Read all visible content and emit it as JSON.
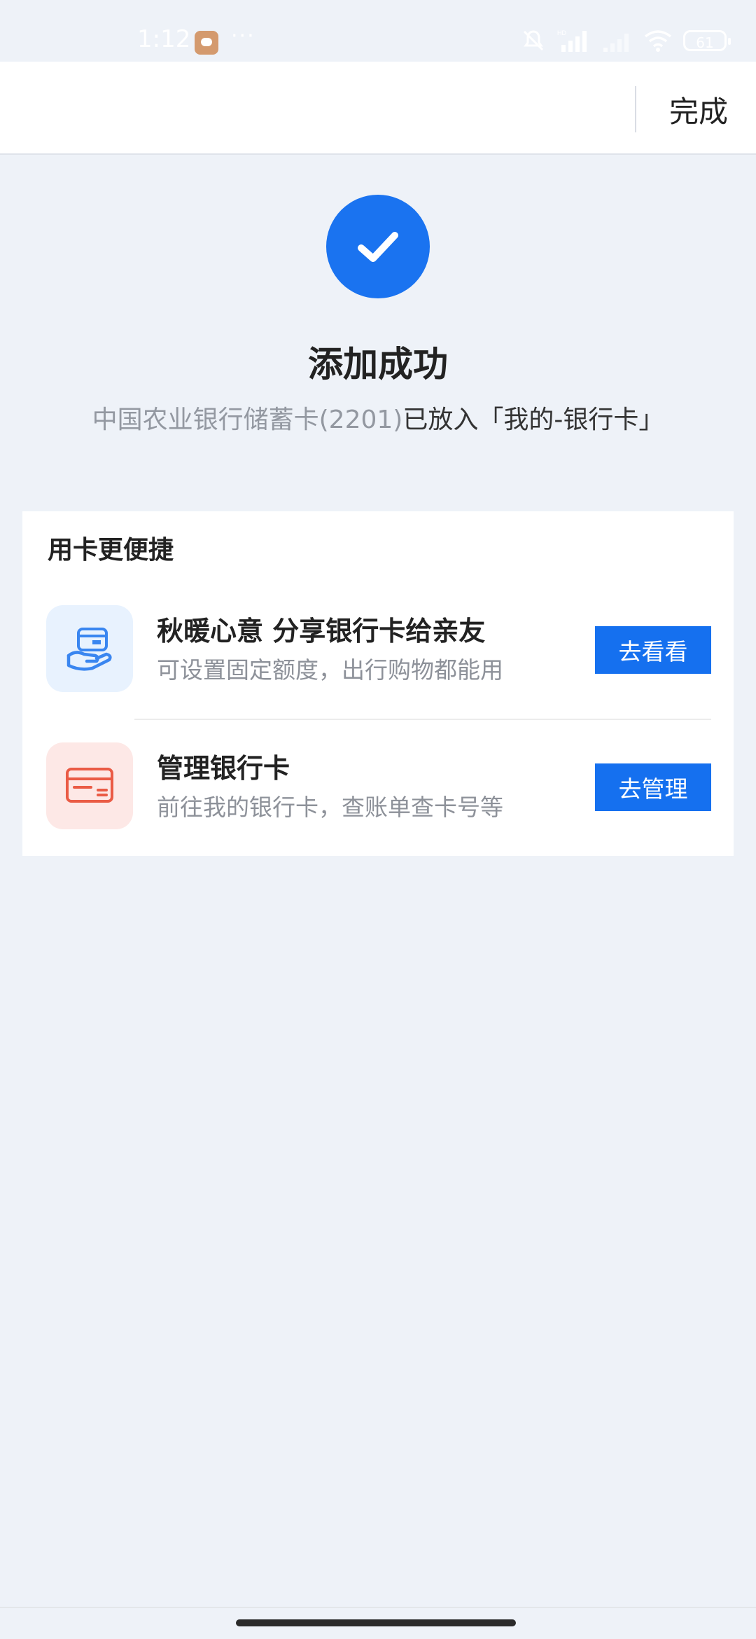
{
  "status_bar": {
    "time": "1:12",
    "dots": "···",
    "battery": "61",
    "icons": [
      "chat-app-icon",
      "bell-muted-icon",
      "signal-hd-icon",
      "signal-icon",
      "wifi-icon",
      "battery-icon"
    ]
  },
  "nav": {
    "done_label": "完成"
  },
  "success": {
    "icon": "check-icon",
    "title": "添加成功",
    "desc_prefix": "中国农业银行储蓄卡(2201)",
    "desc_suffix": "已放入「我的-银行卡」"
  },
  "card": {
    "title": "用卡更便捷",
    "items": [
      {
        "icon": "share-card-hand-icon",
        "title": "秋暖心意 分享银行卡给亲友",
        "subtitle": "可设置固定额度，出行购物都能用",
        "button": "去看看"
      },
      {
        "icon": "bank-card-icon",
        "title": "管理银行卡",
        "subtitle": "前往我的银行卡，查账单查卡号等",
        "button": "去管理"
      }
    ]
  },
  "colors": {
    "accent": "#1570ef",
    "background": "#eef2f8",
    "success_circle": "#1a73f0",
    "pink_icon_bg": "#fde8e6",
    "blue_icon_bg": "#e8f2fe"
  }
}
